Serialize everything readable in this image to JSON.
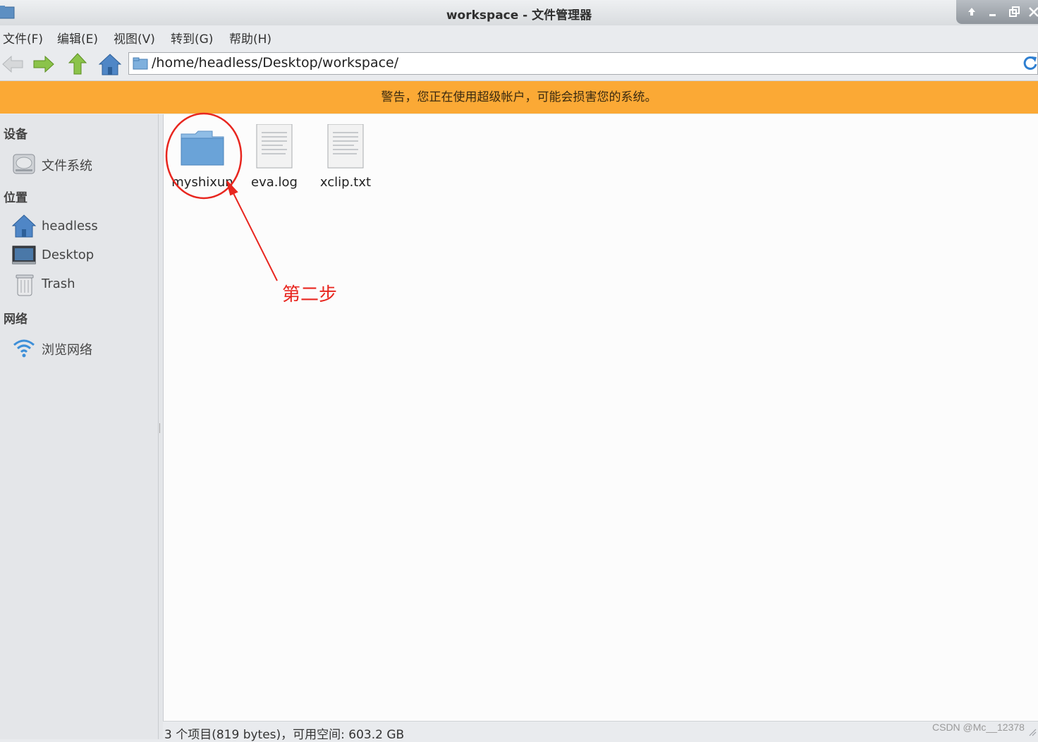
{
  "window": {
    "title": "workspace - 文件管理器",
    "controls": [
      "up-icon",
      "minimize-icon",
      "restore-icon",
      "close-icon"
    ]
  },
  "menubar": {
    "items": [
      "文件(F)",
      "编辑(E)",
      "视图(V)",
      "转到(G)",
      "帮助(H)"
    ]
  },
  "toolbar": {
    "buttons": [
      "back-arrow-icon",
      "forward-arrow-icon",
      "up-arrow-icon",
      "home-icon"
    ],
    "path": "/home/headless/Desktop/workspace/",
    "reload_icon": "reload-icon"
  },
  "warning": {
    "text": "警告，您正在使用超级帐户，可能会损害您的系统。",
    "color": "#fba935"
  },
  "sidebar": {
    "sections": [
      {
        "heading": "设备",
        "items": [
          {
            "label": "文件系统",
            "icon": "harddisk-icon"
          }
        ]
      },
      {
        "heading": "位置",
        "items": [
          {
            "label": "headless",
            "icon": "home-icon"
          },
          {
            "label": "Desktop",
            "icon": "desktop-icon"
          },
          {
            "label": "Trash",
            "icon": "trash-icon"
          }
        ]
      },
      {
        "heading": "网络",
        "items": [
          {
            "label": "浏览网络",
            "icon": "network-icon"
          }
        ]
      }
    ]
  },
  "files": [
    {
      "name": "myshixun",
      "type": "folder",
      "icon": "folder-icon"
    },
    {
      "name": "eva.log",
      "type": "file",
      "icon": "text-file-icon"
    },
    {
      "name": "xclip.txt",
      "type": "file",
      "icon": "text-file-icon"
    }
  ],
  "annotation": {
    "label": "第二步",
    "color": "#e8261f"
  },
  "status": {
    "text": "3 个项目(819 bytes)，可用空间: 603.2 GB"
  },
  "watermark": "CSDN @Mc__12378"
}
